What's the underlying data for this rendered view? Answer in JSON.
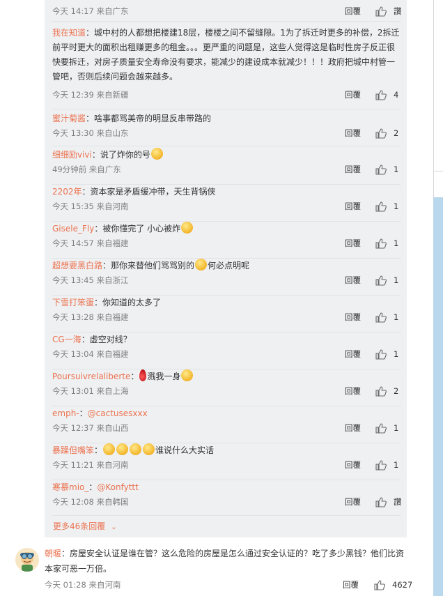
{
  "replies": [
    {
      "user": "",
      "text": "",
      "time": "今天 14:17 来自广东",
      "reply_label": "回覆",
      "likes": "讚"
    },
    {
      "user": "我在知道",
      "text": "：城中村的人都想把楼建18层，楼楼之间不留缝隙。1为了拆迁时更多的补偿，2拆迁前平时更大的面积出租赚更多的租金。。。更严重的问题是，这些人觉得这是临时性房子反正很快要拆迁，对房子质量安全寿命没有要求，能减少的建设成本就减少！！！政府把城中村管一管吧，否则后续问题会越来越多。",
      "time": "今天 12:39 来自新疆",
      "reply_label": "回覆",
      "likes": "4"
    },
    {
      "user": "蜜汁菊酱",
      "text": "：啥事都骂美帝的明显反串带路的",
      "time": "今天 13:30 来自山东",
      "reply_label": "回覆",
      "likes": "2"
    },
    {
      "user": "细细励vivi",
      "text": "：说了炸你的号",
      "time": "49分钟前 来自广东",
      "reply_label": "回覆",
      "likes": "1"
    },
    {
      "user": "2202年",
      "text": "：资本家是矛盾缓冲带，天生背锅侠",
      "time": "今天 15:35 来自河南",
      "reply_label": "回覆",
      "likes": "1"
    },
    {
      "user": "Gisele_Fly",
      "text": "：被你懂完了 小心被炸",
      "time": "今天 14:57 来自福建",
      "reply_label": "回覆",
      "likes": "1"
    },
    {
      "user": "超想要黑白路",
      "text": "：那你来替他们骂骂别的",
      "text2": "何必点明呢",
      "time": "今天 13:45 来自浙江",
      "reply_label": "回覆",
      "likes": "1"
    },
    {
      "user": "下雪打笨蛋",
      "text": "：你知道的太多了",
      "time": "今天 13:28 来自福建",
      "reply_label": "回覆",
      "likes": "1"
    },
    {
      "user": "CG一海",
      "text": "：虚空对线？",
      "time": "今天 13:04 来自福建",
      "reply_label": "回覆",
      "likes": "1"
    },
    {
      "user": "Poursuivrelaliberte",
      "text": "：",
      "text2": "溅我一身",
      "time": "今天 13:01 来自上海",
      "reply_label": "回覆",
      "likes": "2"
    },
    {
      "user": "emph-",
      "text": "：",
      "mention": "@cactusesxxx",
      "time": "今天 12:37 来自山西",
      "reply_label": "回覆",
      "likes": "1"
    },
    {
      "user": "暴躁但嘴笨",
      "text": "：",
      "text2": "谁说什么大实话",
      "time": "今天 11:21 来自河南",
      "reply_label": "回覆",
      "likes": "1"
    },
    {
      "user": "寒慕mio_",
      "text": "：",
      "mention": "@Konfyttt",
      "time": "今天 12:08 来自韩国",
      "reply_label": "回覆",
      "likes": "讚"
    }
  ],
  "more_replies": "更多46条回覆",
  "main_comment": {
    "user": "朝暖",
    "text": "：房屋安全认证是谁在管？这么危险的房屋是怎么通过安全认证的？吃了多少黑钱？他们比资本家可恶一万倍。",
    "time": "今天 01:28 来自河南",
    "reply_label": "回覆",
    "likes": "4627"
  },
  "colors": {
    "accent": "#eb7350",
    "panel": "#eff0f2",
    "background": "#b9d8ee"
  }
}
